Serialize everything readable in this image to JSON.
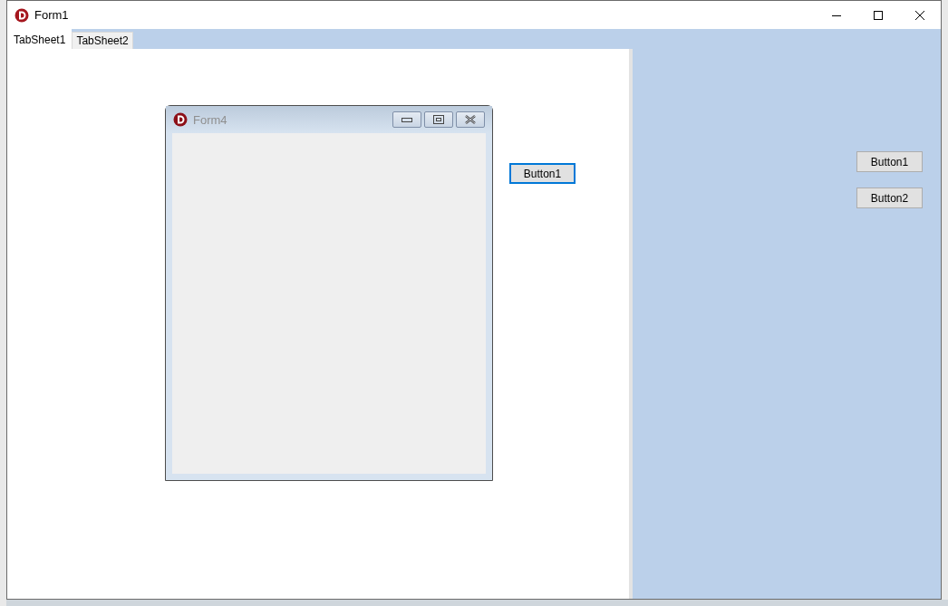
{
  "window": {
    "title": "Form1"
  },
  "tabs": [
    {
      "label": "TabSheet1",
      "selected": true
    },
    {
      "label": "TabSheet2",
      "selected": false
    }
  ],
  "page": {
    "child_window": {
      "title": "Form4"
    },
    "buttons": [
      {
        "label": "Button1",
        "focused": true
      }
    ]
  },
  "side_panel": {
    "buttons": [
      {
        "label": "Button1",
        "focused": false
      },
      {
        "label": "Button2",
        "focused": false
      }
    ]
  }
}
